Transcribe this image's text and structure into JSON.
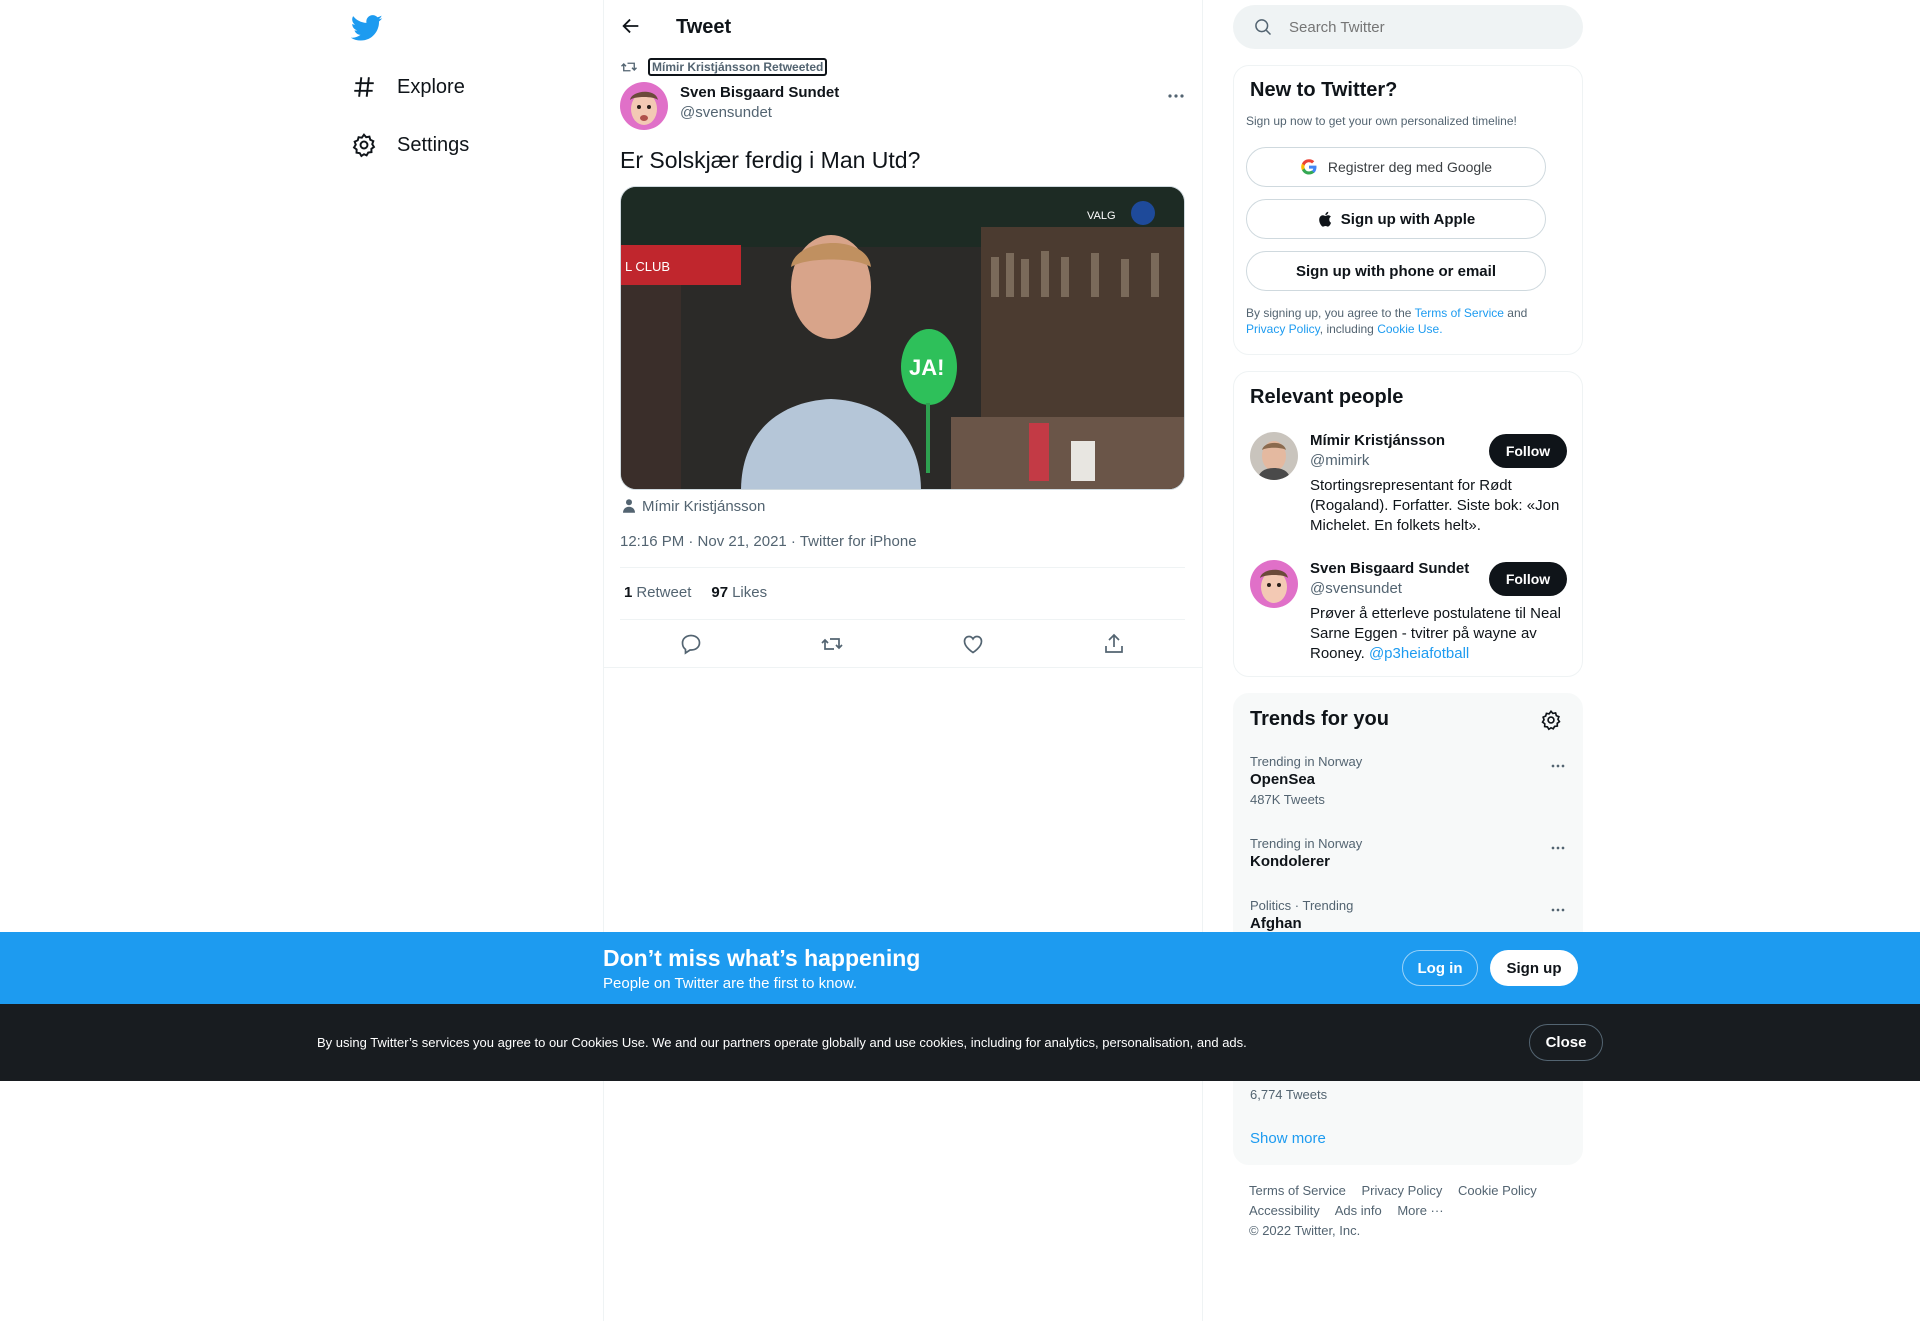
{
  "nav": {
    "items": [
      {
        "label": "Explore",
        "icon": "hashtag-icon"
      },
      {
        "label": "Settings",
        "icon": "gear-icon"
      }
    ]
  },
  "header": {
    "title": "Tweet"
  },
  "tweet": {
    "retweeted_by": "Mímir Kristjánsson Retweeted",
    "author_name": "Sven Bisgaard Sundet",
    "author_handle": "@svensundet",
    "text": "Er Solskjær ferdig i Man Utd?",
    "media_credit": "Mímir Kristjánsson",
    "media_overlay": {
      "sign": "JA!",
      "club_banner": "L CLUB",
      "channel": "VALG"
    },
    "meta": "12:16 PM · Nov 21, 2021 · Twitter for iPhone",
    "retweets_count": "1",
    "retweets_label": "Retweet",
    "likes_count": "97",
    "likes_label": "Likes"
  },
  "search": {
    "placeholder": "Search Twitter"
  },
  "new_to_twitter": {
    "title": "New to Twitter?",
    "subtitle": "Sign up now to get your own personalized timeline!",
    "google_label": "Registrer deg med Google",
    "apple_label": "Sign up with Apple",
    "phone_label": "Sign up with phone or email",
    "terms_prefix": "By signing up, you agree to the",
    "terms_link": "Terms of Service",
    "terms_and": "and",
    "privacy_link": "Privacy Policy",
    "including": ", including",
    "cookie_link": "Cookie Use."
  },
  "relevant_people": {
    "title": "Relevant people",
    "people": [
      {
        "name": "Mímir Kristjánsson",
        "handle": "@mimirk",
        "follow_label": "Follow",
        "bio": "Stortingsrepresentant for Rødt (Rogaland). Forfatter. Siste bok: «Jon Michelet. En folkets helt»."
      },
      {
        "name": "Sven Bisgaard Sundet",
        "handle": "@svensundet",
        "follow_label": "Follow",
        "bio": "Prøver å etterleve postulatene til Neal Sarne Eggen - tvitrer på wayne av Rooney.",
        "bio_link": "@p3heiafotball"
      }
    ]
  },
  "trends": {
    "title": "Trends for you",
    "items": [
      {
        "category": "Trending in Norway",
        "name": "OpenSea",
        "count": "487K Tweets"
      },
      {
        "category": "Trending in Norway",
        "name": "Kondolerer",
        "count": ""
      },
      {
        "category": "Politics · Trending",
        "name": "Afghan",
        "count": ""
      },
      {
        "category": "",
        "name": "",
        "count": "6,774 Tweets"
      }
    ],
    "show_more": "Show more"
  },
  "footer": {
    "links": [
      "Terms of Service",
      "Privacy Policy",
      "Cookie Policy",
      "Accessibility",
      "Ads info",
      "More ···"
    ],
    "copyright": "© 2022 Twitter, Inc."
  },
  "signup_bar": {
    "title": "Don’t miss what’s happening",
    "subtitle": "People on Twitter are the first to know.",
    "login_label": "Log in",
    "signup_label": "Sign up"
  },
  "cookie_bar": {
    "text": "By using Twitter’s services you agree to our Cookies Use. We and our partners operate globally and use cookies, including for analytics, personalisation, and ads.",
    "close_label": "Close"
  },
  "colors": {
    "accent": "#1d9bf0",
    "text": "#0f1419",
    "muted": "#536471",
    "dark_bar": "#181c20"
  }
}
